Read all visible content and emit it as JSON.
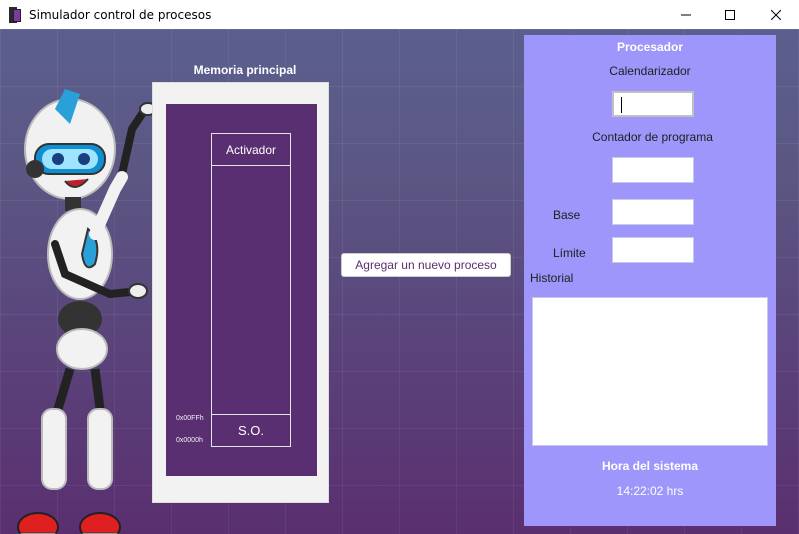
{
  "window": {
    "title": "Simulador control de procesos",
    "controls": {
      "minimize": "—",
      "maximize": "☐",
      "close": "✕"
    }
  },
  "memory": {
    "title": "Memoria principal",
    "activator_label": "Activador",
    "os_label": "S.O.",
    "address_high": "0x00FFh",
    "address_low": "0x0000h"
  },
  "actions": {
    "add_process_label": "Agregar un nuevo proceso"
  },
  "processor": {
    "title": "Procesador",
    "scheduler_label": "Calendarizador",
    "scheduler_value": "",
    "program_counter_label": "Contador de programa",
    "program_counter_value": "",
    "base_label": "Base",
    "base_value": "",
    "limit_label": "Límite",
    "limit_value": "",
    "history_label": "Historial",
    "history_value": "",
    "system_time_title": "Hora del sistema",
    "system_time_value": "14:22:02 hrs"
  },
  "colors": {
    "background_top": "#5b5f8e",
    "background_bottom": "#5a2f6f",
    "memory_inner": "#5a2f72",
    "processor_panel": "#9f96fc",
    "button_text": "#5a2f6f"
  },
  "icons": {
    "app": "app-icon",
    "mascot": "robot-illustration"
  }
}
